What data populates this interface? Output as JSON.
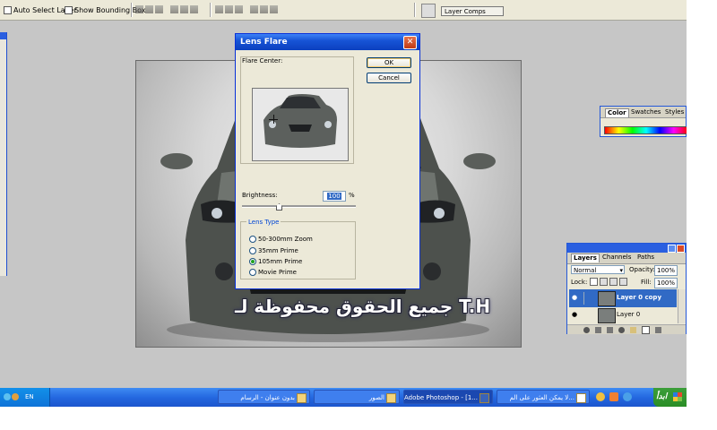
{
  "options_bar": {
    "auto_select_layer": "Auto Select Layer",
    "show_bounding_box": "Show Bounding Box",
    "layer_comps_tab": "Layer Comps"
  },
  "canvas": {
    "watermark_text": "جميع الحقوق محفوظة لـ T.H"
  },
  "lens_flare": {
    "title": "Lens Flare",
    "flare_center_label": "Flare Center:",
    "ok_label": "OK",
    "cancel_label": "Cancel",
    "brightness_label": "Brightness:",
    "brightness_value": "100",
    "percent_sign": "%",
    "lens_type_label": "Lens Type",
    "lens_options": [
      "50-300mm Zoom",
      "35mm Prime",
      "105mm Prime",
      "Movie Prime"
    ],
    "selected_lens": "105mm Prime"
  },
  "color_panel": {
    "tabs": [
      "Color",
      "Swatches",
      "Styles"
    ],
    "active_tab": "Color"
  },
  "layers_panel": {
    "tabs": [
      "Layers",
      "Channels",
      "Paths"
    ],
    "active_tab": "Layers",
    "blend_mode": "Normal",
    "opacity_label": "Opacity:",
    "opacity_value": "100%",
    "lock_label": "Lock:",
    "fill_label": "Fill:",
    "fill_value": "100%",
    "layers": [
      {
        "name": "Layer 0 copy",
        "selected": true
      },
      {
        "name": "Layer 0",
        "selected": false
      }
    ]
  },
  "taskbar": {
    "items": [
      {
        "label": "بدون عنوان - الرسام",
        "active": false
      },
      {
        "label": "الصور",
        "active": false
      },
      {
        "label": "Adobe Photoshop - [1...",
        "active": true
      },
      {
        "label": "لا يمكن العثور على الم...",
        "active": false
      }
    ],
    "language": "EN"
  },
  "colors": {
    "xp_blue": "#2468e0",
    "dialog_face": "#ece9d8",
    "layer_selected": "#316ac5"
  }
}
